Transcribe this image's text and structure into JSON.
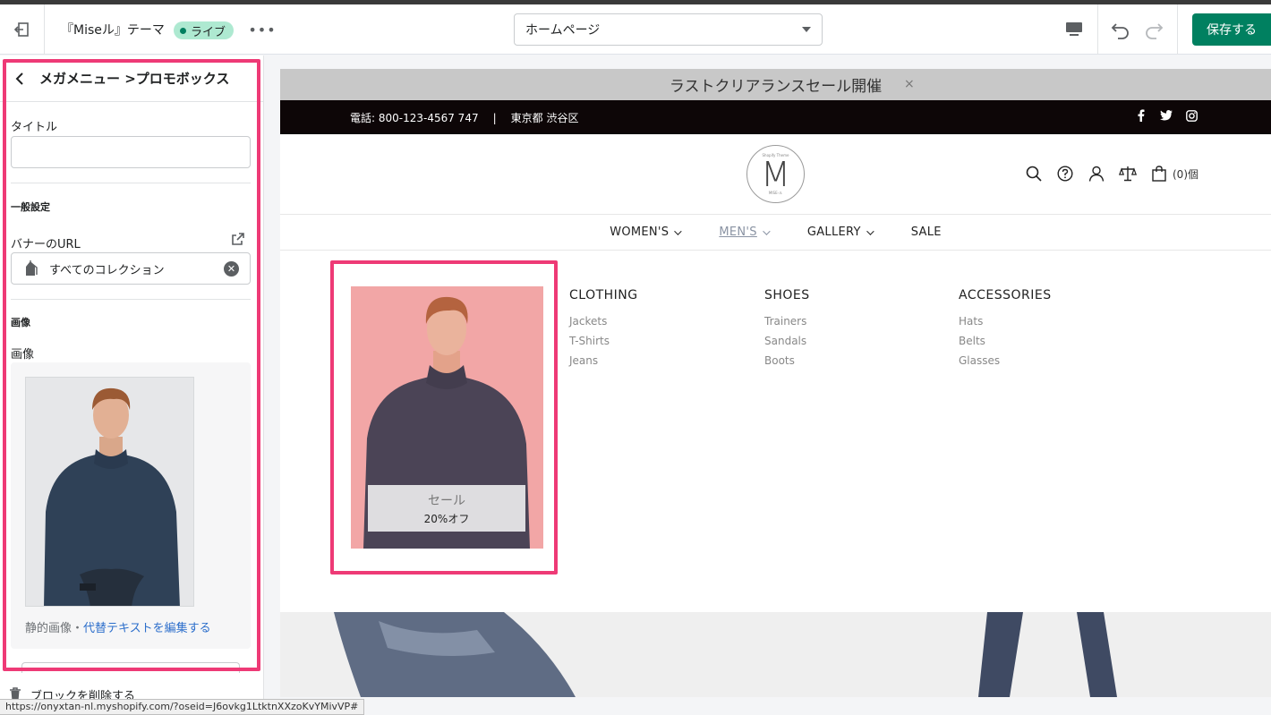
{
  "topbar": {
    "theme_name": "『Miseル』テーマ",
    "live_badge": "ライブ",
    "page_select": "ホームページ",
    "save_label": "保存する"
  },
  "sidebar": {
    "title": "メガメニュー >プロモボックス",
    "title_field_label": "タイトル",
    "title_field_value": "",
    "general_heading": "一般設定",
    "banner_url_label": "バナーのURL",
    "banner_url_value": "すべてのコレクション",
    "image_heading": "画像",
    "image_label": "画像",
    "static_image_text": "静的画像・",
    "alt_text_link": "代替テキストを編集する",
    "delete_block": "ブロックを削除する"
  },
  "status_url": "https://onyxtan-nl.myshopify.com/?oseid=J6ovkg1LtktnXXzoKvYMivVP#",
  "preview": {
    "announcement": "ラストクリアランスセール開催",
    "announcement_close": "×",
    "phone": "電話: 800-123-4567 747",
    "separator": "|",
    "address": "東京都 渋谷区",
    "logo_letter": "M",
    "logo_small_top": "Shopify Theme",
    "logo_small_bottom": "MISE-ル",
    "cart_count": "(0)個",
    "nav": [
      {
        "label": "WOMEN'S"
      },
      {
        "label": "MEN'S"
      },
      {
        "label": "GALLERY"
      },
      {
        "label": "SALE"
      }
    ],
    "promo": {
      "line1": "セール",
      "line2": "20%オフ"
    },
    "columns": [
      {
        "title": "CLOTHING",
        "links": [
          "Jackets",
          "T-Shirts",
          "Jeans"
        ]
      },
      {
        "title": "SHOES",
        "links": [
          "Trainers",
          "Sandals",
          "Boots"
        ]
      },
      {
        "title": "ACCESSORIES",
        "links": [
          "Hats",
          "Belts",
          "Glasses"
        ]
      }
    ]
  },
  "colors": {
    "accent_green": "#008060",
    "highlight_pink": "#ee3a76",
    "live_badge_bg": "#aee9d1",
    "promo_bg": "#f2a6a6"
  },
  "icons": [
    "exit-icon",
    "more-icon",
    "desktop-icon",
    "undo-icon",
    "redo-icon",
    "back-chevron-icon",
    "external-link-icon",
    "collection-tag-icon",
    "clear-icon",
    "trash-icon",
    "facebook-icon",
    "twitter-icon",
    "instagram-icon",
    "search-icon",
    "help-icon",
    "account-icon",
    "compare-icon",
    "cart-icon"
  ]
}
